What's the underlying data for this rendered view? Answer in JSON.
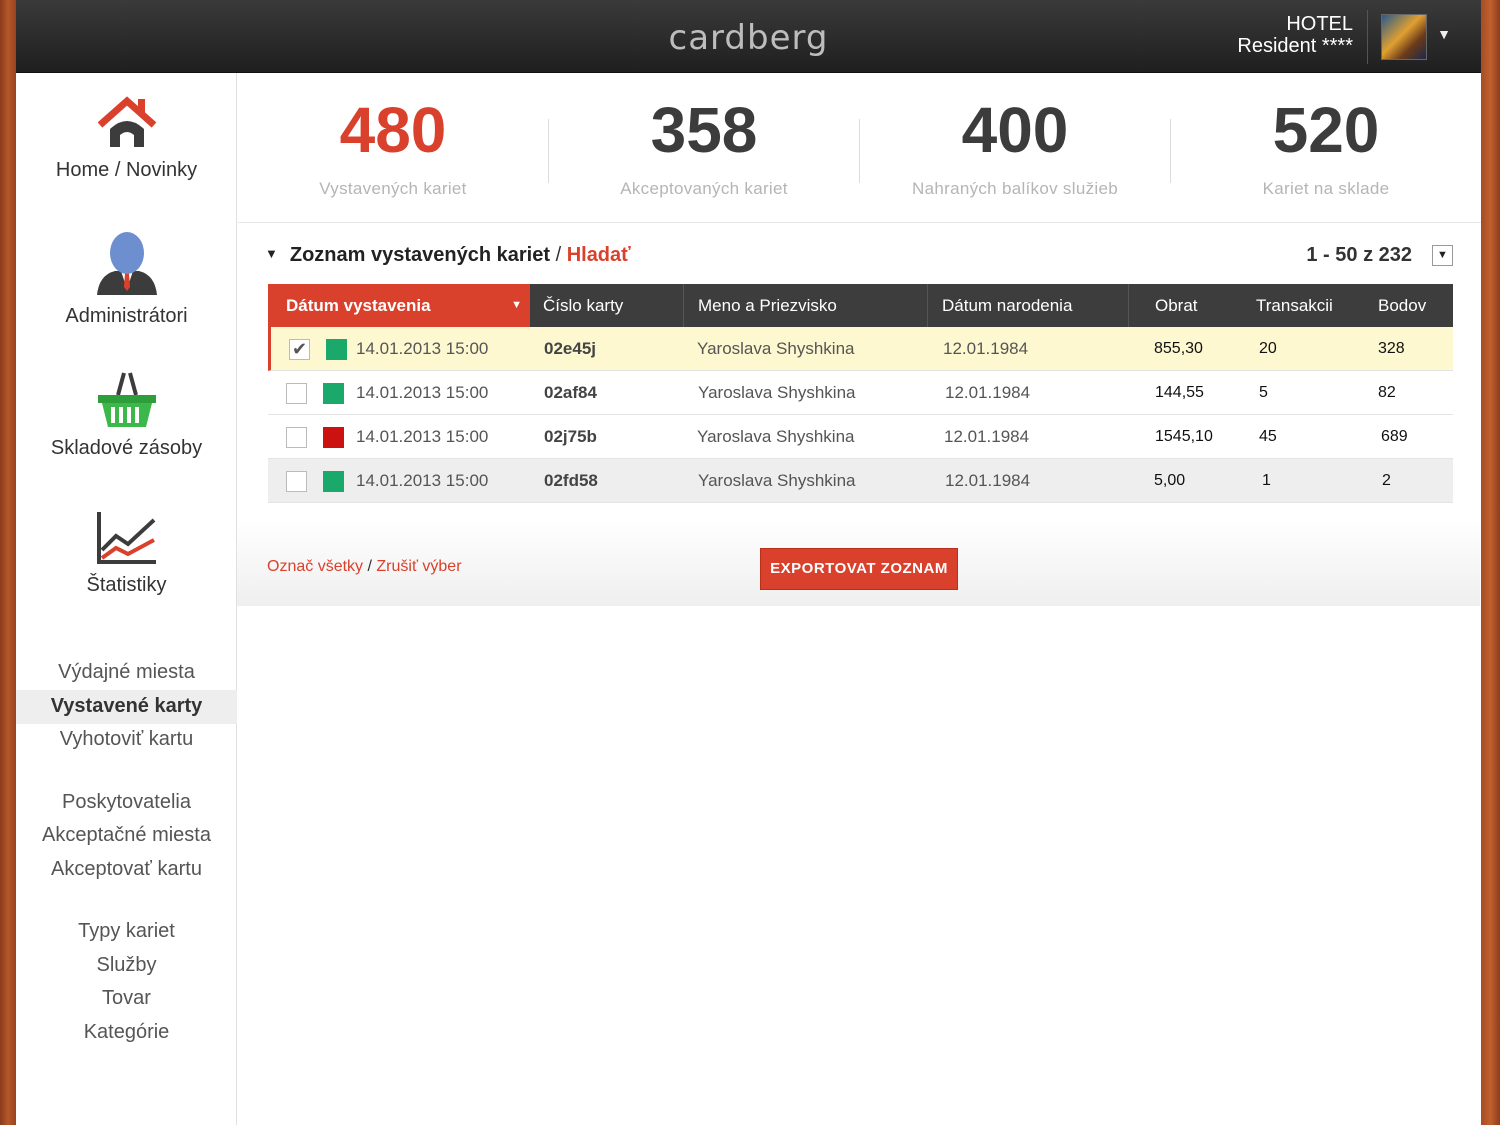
{
  "header": {
    "logo": "cardberg",
    "hotel_line1": "HOTEL",
    "hotel_line2": "Resident ****"
  },
  "sidebar": {
    "main_items": [
      {
        "label": "Home / Novinky",
        "icon": "home-icon"
      },
      {
        "label": "Administrátori",
        "icon": "user-icon"
      },
      {
        "label": "Skladové zásoby",
        "icon": "basket-icon"
      },
      {
        "label": "Štatistiky",
        "icon": "chart-icon"
      }
    ],
    "group1": [
      "Výdajné miesta",
      "Vystavené karty",
      "Vyhotoviť kartu"
    ],
    "group2": [
      "Poskytovatelia",
      "Akceptačné miesta",
      "Akceptovať kartu"
    ],
    "group3": [
      "Typy kariet",
      "Služby",
      "Tovar",
      "Kategórie"
    ],
    "active": "Vystavené karty"
  },
  "stats": [
    {
      "value": "480",
      "label": "Vystavených kariet"
    },
    {
      "value": "358",
      "label": "Akceptovaných kariet"
    },
    {
      "value": "400",
      "label": "Nahraných balíkov služieb"
    },
    {
      "value": "520",
      "label": "Kariet na sklade"
    }
  ],
  "list": {
    "title": "Zoznam vystavených kariet",
    "separator": "/",
    "search_link": "Hladať",
    "pager": "1 - 50 z 232",
    "columns": [
      "Dátum vystavenia",
      "Číslo karty",
      "Meno a Priezvisko",
      "Dátum narodenia",
      "Obrat",
      "Transakcii",
      "Bodov"
    ],
    "rows": [
      {
        "checked": true,
        "status_color": "#1aa96a",
        "date": "14.01.2013 15:00",
        "card": "02e45j",
        "name": "Yaroslava Shyshkina",
        "birth": "12.01.1984",
        "turnover": "855,30",
        "transactions": "20",
        "points": "328"
      },
      {
        "checked": false,
        "status_color": "#1aa96a",
        "date": "14.01.2013 15:00",
        "card": "02af84",
        "name": "Yaroslava Shyshkina",
        "birth": "12.01.1984",
        "turnover": "144,55",
        "transactions": "5",
        "points": "82"
      },
      {
        "checked": false,
        "status_color": "#cc1111",
        "date": "14.01.2013 15:00",
        "card": "02j75b",
        "name": "Yaroslava Shyshkina",
        "birth": "12.01.1984",
        "turnover": "1545,10",
        "transactions": "45",
        "points": "689"
      },
      {
        "checked": false,
        "status_color": "#1aa96a",
        "date": "14.01.2013 15:00",
        "card": "02fd58",
        "name": "Yaroslava Shyshkina",
        "birth": "12.01.1984",
        "turnover": "5,00",
        "transactions": "1",
        "points": "2"
      }
    ]
  },
  "footer": {
    "select_all": "Označ všetky",
    "link_sep": "/",
    "deselect": "Zrušiť výber",
    "export": "EXPORTOVAT ZOZNAM"
  },
  "colors": {
    "accent": "#d9412c",
    "header": "#2b2b2b",
    "status_ok": "#1aa96a",
    "status_bad": "#cc1111"
  }
}
